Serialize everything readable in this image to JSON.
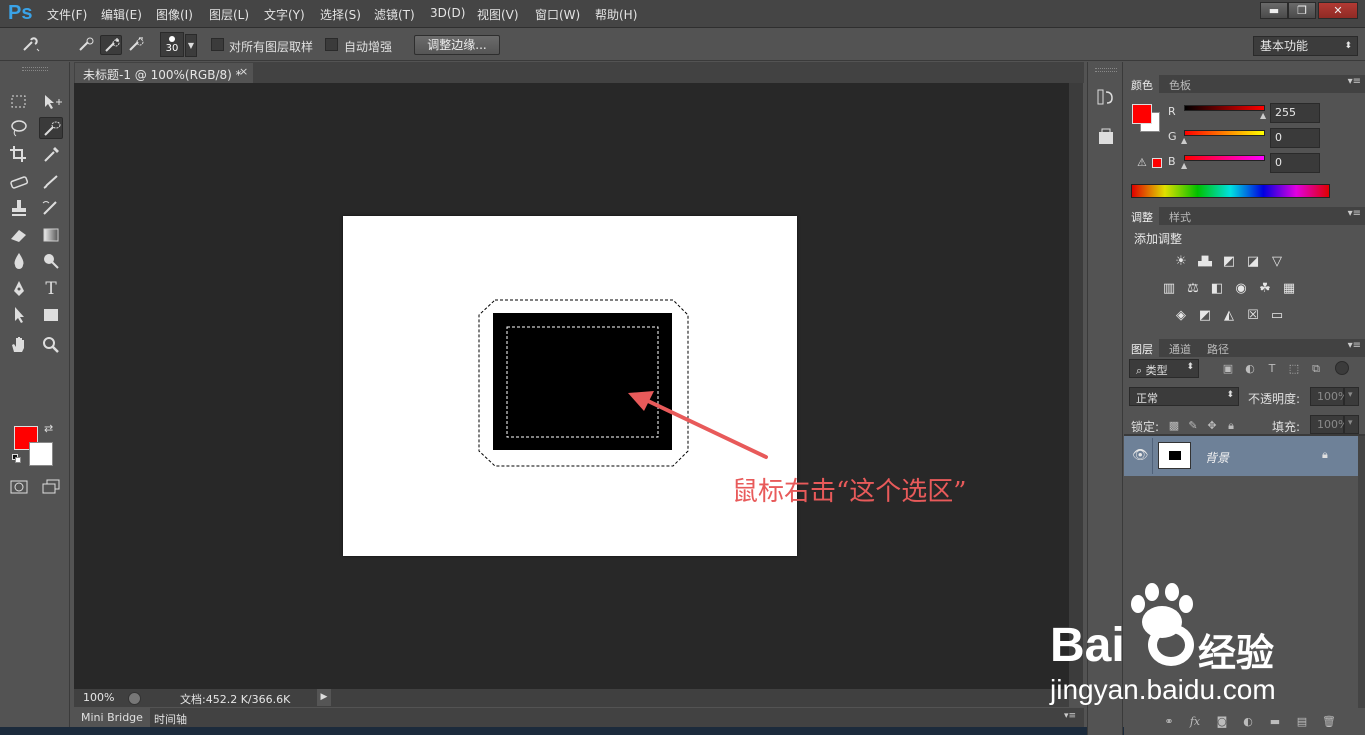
{
  "app": {
    "logo": "Ps",
    "menu": [
      "文件(F)",
      "编辑(E)",
      "图像(I)",
      "图层(L)",
      "文字(Y)",
      "选择(S)",
      "滤镜(T)",
      "3D(D)",
      "视图(V)",
      "窗口(W)",
      "帮助(H)"
    ],
    "window_buttons": {
      "minimize": "▬",
      "restore": "❐",
      "close": "✕"
    }
  },
  "options": {
    "brush_size": "30",
    "sample_all_layers": "对所有图层取样",
    "auto_enhance": "自动增强",
    "refine_edge": "调整边缘...",
    "workspace": "基本功能"
  },
  "document": {
    "tab_title": "未标题-1 @ 100%(RGB/8) *",
    "tab_close": "×",
    "zoom": "100%",
    "doc_info": "文档:452.2 K/366.6K",
    "annotation": "鼠标右击“这个选区”",
    "colors": {
      "canvas": "#ffffff",
      "fill": "#000000",
      "annotation": "#e85a5a"
    }
  },
  "bottom_tabs": [
    "Mini Bridge",
    "时间轴"
  ],
  "color_panel": {
    "tabs": [
      "颜色",
      "色板"
    ],
    "channels": [
      {
        "label": "R",
        "value": "255"
      },
      {
        "label": "G",
        "value": "0"
      },
      {
        "label": "B",
        "value": "0"
      }
    ],
    "foreground": "#ff0000",
    "background": "#ffffff"
  },
  "adjust_panel": {
    "tabs": [
      "调整",
      "样式"
    ],
    "title": "添加调整",
    "icons": [
      "brightness-icon",
      "levels-icon",
      "curves-icon",
      "exposure-icon",
      "vibrance-icon",
      "hue-saturation-icon",
      "color-balance-icon",
      "black-white-icon",
      "photo-filter-icon",
      "channel-mixer-icon",
      "color-lookup-icon",
      "invert-icon",
      "posterize-icon",
      "threshold-icon",
      "selective-color-icon",
      "gradient-map-icon"
    ]
  },
  "layers_panel": {
    "tabs": [
      "图层",
      "通道",
      "路径"
    ],
    "filter_type": "类型",
    "blend_mode": "正常",
    "opacity_label": "不透明度:",
    "opacity_value": "100%",
    "lock_label": "锁定:",
    "fill_label": "填充:",
    "fill_value": "100%",
    "layers": [
      {
        "name": "背景",
        "locked": true,
        "visible": true
      }
    ]
  },
  "watermark": {
    "brand": "Bai",
    "brand_cn": "经验",
    "url": "jingyan.baidu.com"
  }
}
